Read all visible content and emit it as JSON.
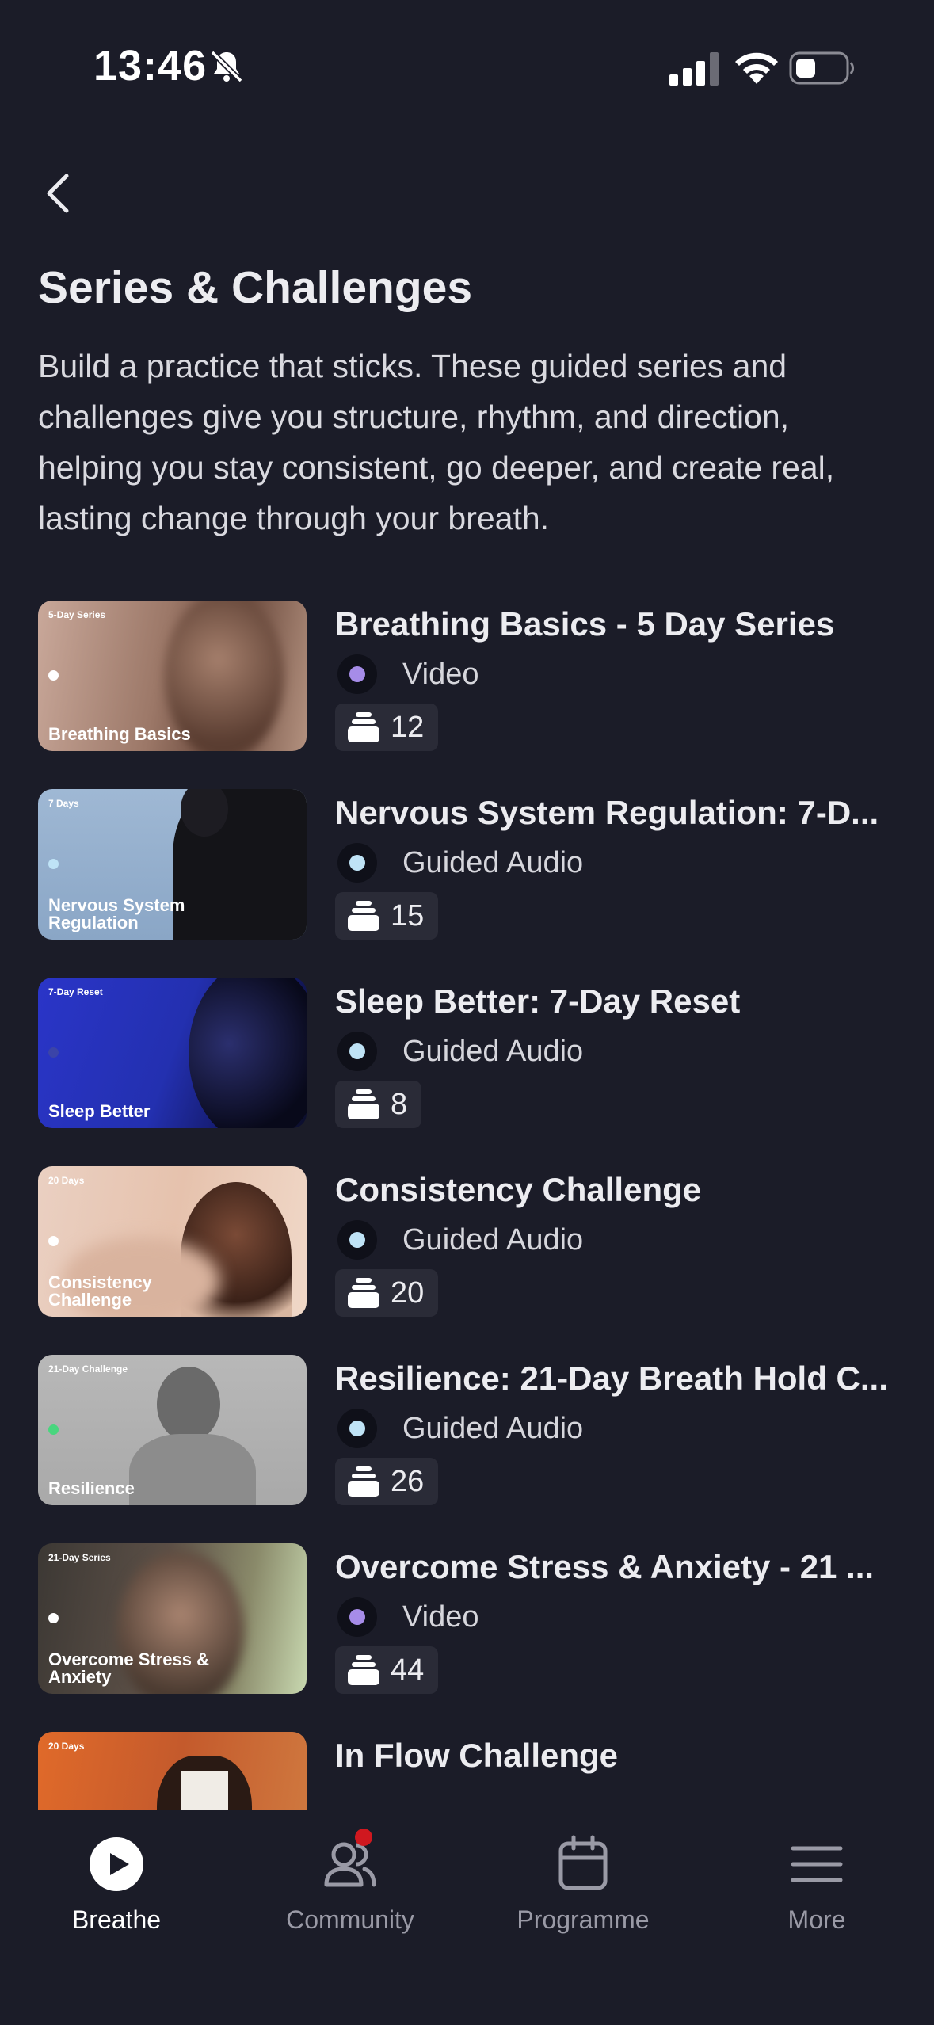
{
  "status_bar": {
    "time": "13:46"
  },
  "page": {
    "title": "Series & Challenges",
    "description": "Build a practice that sticks. These guided series and challenges give you structure, rhythm, and direction, helping you stay consistent, go deeper, and create real, lasting change through your breath."
  },
  "series": [
    {
      "name": "Breathing Basics - 5 Day Series",
      "type": "Video",
      "type_color": "#a68ce8",
      "count": "12",
      "thumb_tag": "5-Day Series",
      "thumb_title": "Breathing Basics"
    },
    {
      "name": "Nervous System Regulation: 7-D...",
      "type": "Guided Audio",
      "type_color": "#bfe3f6",
      "count": "15",
      "thumb_tag": "7 Days",
      "thumb_title": "Nervous System Regulation"
    },
    {
      "name": "Sleep Better: 7-Day Reset",
      "type": "Guided Audio",
      "type_color": "#bfe3f6",
      "count": "8",
      "thumb_tag": "7-Day Reset",
      "thumb_title": "Sleep Better"
    },
    {
      "name": "Consistency Challenge",
      "type": "Guided Audio",
      "type_color": "#bfe3f6",
      "count": "20",
      "thumb_tag": "20 Days",
      "thumb_title": "Consistency Challenge"
    },
    {
      "name": "Resilience: 21-Day Breath Hold C...",
      "type": "Guided Audio",
      "type_color": "#bfe3f6",
      "count": "26",
      "thumb_tag": "21-Day Challenge",
      "thumb_title": "Resilience"
    },
    {
      "name": "Overcome Stress & Anxiety - 21 ...",
      "type": "Video",
      "type_color": "#a68ce8",
      "count": "44",
      "thumb_tag": "21-Day Series",
      "thumb_title": "Overcome Stress & Anxiety"
    },
    {
      "name": "In Flow Challenge",
      "thumb_tag": "20 Days"
    }
  ],
  "tabs": [
    {
      "label": "Breathe",
      "icon": "play-circle-icon",
      "active": true
    },
    {
      "label": "Community",
      "icon": "users-icon",
      "active": false
    },
    {
      "label": "Programme",
      "icon": "calendar-icon",
      "active": false
    },
    {
      "label": "More",
      "icon": "menu-icon",
      "active": false
    }
  ]
}
